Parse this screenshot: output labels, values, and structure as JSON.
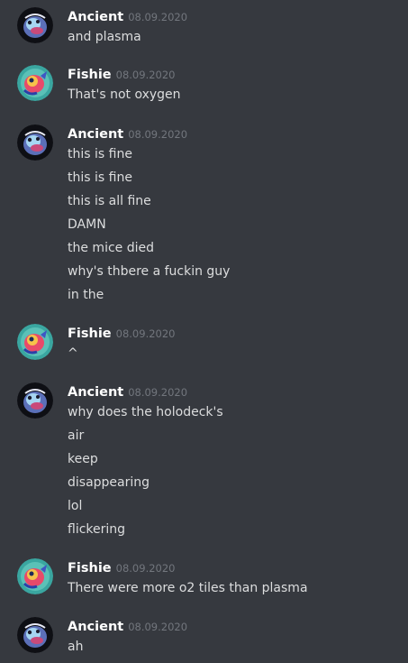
{
  "groups": [
    {
      "author": "Ancient",
      "avatar": "ancient-avatar",
      "timestamp": "08.09.2020",
      "lines": [
        "and plasma"
      ]
    },
    {
      "author": "Fishie",
      "avatar": "fishie-avatar",
      "timestamp": "08.09.2020",
      "lines": [
        "That's not oxygen"
      ]
    },
    {
      "author": "Ancient",
      "avatar": "ancient-avatar",
      "timestamp": "08.09.2020",
      "lines": [
        "this is fine",
        "this is fine",
        "this is all fine",
        "DAMN",
        "the mice died",
        "why's thbere a fuckin guy",
        "in the"
      ]
    },
    {
      "author": "Fishie",
      "avatar": "fishie-avatar",
      "timestamp": "08.09.2020",
      "lines": [
        "^"
      ]
    },
    {
      "author": "Ancient",
      "avatar": "ancient-avatar",
      "timestamp": "08.09.2020",
      "lines": [
        "why does the holodeck's",
        "air",
        "keep",
        "disappearing",
        "lol",
        "flickering"
      ]
    },
    {
      "author": "Fishie",
      "avatar": "fishie-avatar",
      "timestamp": "08.09.2020",
      "lines": [
        "There were more o2 tiles than plasma"
      ]
    },
    {
      "author": "Ancient",
      "avatar": "ancient-avatar",
      "timestamp": "08.09.2020",
      "lines": [
        "ah"
      ]
    }
  ],
  "colors": {
    "background": "#36393f",
    "author": "#ffffff",
    "timestamp": "#72767d",
    "text": "#dcddde"
  }
}
